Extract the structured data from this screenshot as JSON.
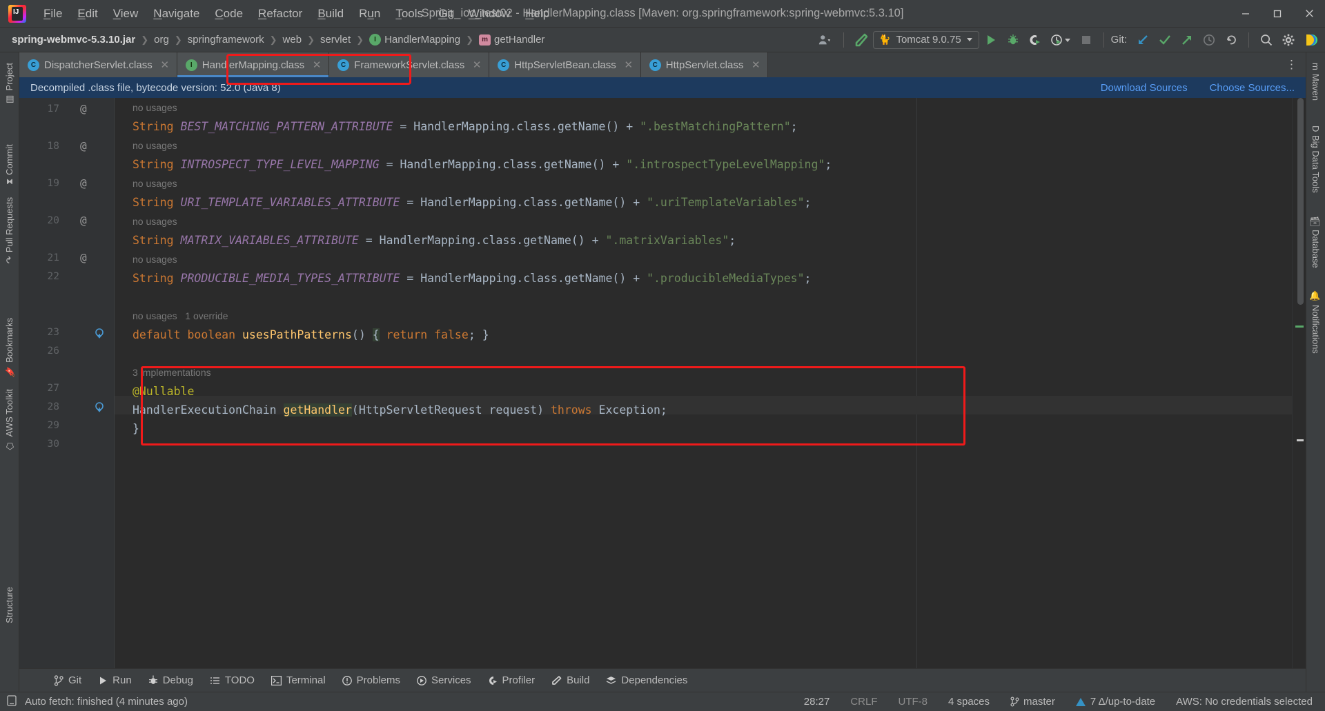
{
  "window": {
    "title": "Spring_ioc_test02 - HandlerMapping.class [Maven: org.springframework:spring-webmvc:5.3.10]",
    "minimize_label": "minimize-icon",
    "maximize_label": "maximize-icon",
    "close_label": "close-icon"
  },
  "menu": {
    "items": [
      {
        "label": "File",
        "mnemonic": "F"
      },
      {
        "label": "Edit",
        "mnemonic": "E"
      },
      {
        "label": "View",
        "mnemonic": "V"
      },
      {
        "label": "Navigate",
        "mnemonic": "N"
      },
      {
        "label": "Code",
        "mnemonic": "C"
      },
      {
        "label": "Refactor",
        "mnemonic": "R"
      },
      {
        "label": "Build",
        "mnemonic": "B"
      },
      {
        "label": "Run",
        "mnemonic": "u"
      },
      {
        "label": "Tools",
        "mnemonic": "T"
      },
      {
        "label": "Git",
        "mnemonic": "G"
      },
      {
        "label": "Window",
        "mnemonic": "W"
      },
      {
        "label": "Help",
        "mnemonic": "H"
      }
    ]
  },
  "breadcrumbs": [
    {
      "label": "spring-webmvc-5.3.10.jar",
      "icon": ""
    },
    {
      "label": "org",
      "icon": ""
    },
    {
      "label": "springframework",
      "icon": ""
    },
    {
      "label": "web",
      "icon": ""
    },
    {
      "label": "servlet",
      "icon": ""
    },
    {
      "label": "HandlerMapping",
      "icon": "I"
    },
    {
      "label": "getHandler",
      "icon": "m"
    }
  ],
  "toolbar": {
    "profile_icon": "user-profile-icon",
    "build_icon": "build-hammer-icon",
    "run_config": "Tomcat 9.0.75",
    "run_config_icon": "tomcat-cat-icon",
    "run_icon": "run-play-icon",
    "debug_icon": "debug-bug-icon",
    "run_coverage_icon": "run-with-coverage-icon",
    "profiler_icon": "profiler-clock-icon",
    "stop_icon": "stop-square-icon",
    "git_label": "Git:",
    "git_update_icon": "git-update-project-icon",
    "git_commit_icon": "git-commit-checkmark-icon",
    "git_push_icon": "git-push-arrow-icon",
    "git_history_icon": "git-history-clock-icon",
    "git_rollback_icon": "git-rollback-icon",
    "search_icon": "search-icon",
    "settings_icon": "gear-icon",
    "ai_icon": "ai-assistant-icon"
  },
  "left_rail": [
    {
      "label": "Project",
      "icon": "project-icon"
    },
    {
      "label": "Commit",
      "icon": "commit-icon"
    },
    {
      "label": "Pull Requests",
      "icon": "pull-requests-icon"
    },
    {
      "label": "Bookmarks",
      "icon": "bookmark-icon"
    },
    {
      "label": "AWS Toolkit",
      "icon": "aws-toolkit-icon"
    },
    {
      "label": "Structure",
      "icon": "structure-icon"
    }
  ],
  "right_rail": [
    {
      "label": "Maven",
      "icon": "maven-icon"
    },
    {
      "label": "Big Data Tools",
      "icon": "big-data-tools-icon"
    },
    {
      "label": "Database",
      "icon": "database-icon"
    },
    {
      "label": "Notifications",
      "icon": "notifications-icon"
    }
  ],
  "tabs": [
    {
      "label": "DispatcherServlet.class",
      "icon": "C",
      "active": false
    },
    {
      "label": "HandlerMapping.class",
      "icon": "I",
      "active": true
    },
    {
      "label": "FrameworkServlet.class",
      "icon": "C",
      "active": false
    },
    {
      "label": "HttpServletBean.class",
      "icon": "C",
      "active": false
    },
    {
      "label": "HttpServlet.class",
      "icon": "C",
      "active": false
    }
  ],
  "tabs_overflow_icon": "more-options-icon",
  "banner": {
    "message": "Decompiled .class file, bytecode version: 52.0 (Java 8)",
    "download_sources": "Download Sources",
    "choose_sources": "Choose Sources..."
  },
  "editor": {
    "lines": [
      {
        "num": "",
        "ann": "",
        "hint": "no usages",
        "type": "hint"
      },
      {
        "num": "17",
        "ann": "@",
        "type": "code",
        "id": "l17"
      },
      {
        "num": "",
        "ann": "",
        "hint": "no usages",
        "type": "hint"
      },
      {
        "num": "18",
        "ann": "@",
        "type": "code",
        "id": "l18"
      },
      {
        "num": "",
        "ann": "",
        "hint": "no usages",
        "type": "hint"
      },
      {
        "num": "19",
        "ann": "@",
        "type": "code",
        "id": "l19"
      },
      {
        "num": "",
        "ann": "",
        "hint": "no usages",
        "type": "hint"
      },
      {
        "num": "20",
        "ann": "@",
        "type": "code",
        "id": "l20"
      },
      {
        "num": "",
        "ann": "",
        "hint": "no usages",
        "type": "hint"
      },
      {
        "num": "21",
        "ann": "@",
        "type": "code",
        "id": "l21"
      },
      {
        "num": "22",
        "ann": "",
        "type": "blank"
      },
      {
        "num": "",
        "ann": "",
        "hint": "no usages   1 override",
        "type": "hint"
      },
      {
        "num": "23",
        "ann": "",
        "type": "code",
        "id": "l23"
      },
      {
        "num": "26",
        "ann": "",
        "type": "blank"
      },
      {
        "num": "",
        "ann": "",
        "hint": "3 implementations",
        "type": "hint"
      },
      {
        "num": "27",
        "ann": "",
        "type": "code",
        "id": "l27"
      },
      {
        "num": "28",
        "ann": "",
        "type": "code",
        "id": "l28"
      },
      {
        "num": "29",
        "ann": "",
        "type": "code",
        "id": "l29"
      },
      {
        "num": "30",
        "ann": "",
        "type": "blank"
      }
    ],
    "source": {
      "l17_keyword": "String",
      "l17_field": "BEST_MATCHING_PATTERN_ATTRIBUTE",
      "l17_expr": " = HandlerMapping.class.getName() + ",
      "l17_string": "\".bestMatchingPattern\"",
      "l18_keyword": "String",
      "l18_field": "INTROSPECT_TYPE_LEVEL_MAPPING",
      "l18_expr": " = HandlerMapping.class.getName() + ",
      "l18_string": "\".introspectTypeLevelMapping\"",
      "l19_keyword": "String",
      "l19_field": "URI_TEMPLATE_VARIABLES_ATTRIBUTE",
      "l19_expr": " = HandlerMapping.class.getName() + ",
      "l19_string": "\".uriTemplateVariables\"",
      "l20_keyword": "String",
      "l20_field": "MATRIX_VARIABLES_ATTRIBUTE",
      "l20_expr": " = HandlerMapping.class.getName() + ",
      "l20_string": "\".matrixVariables\"",
      "l21_keyword": "String",
      "l21_field": "PRODUCIBLE_MEDIA_TYPES_ATTRIBUTE",
      "l21_expr": " = HandlerMapping.class.getName() + ",
      "l21_string": "\".producibleMediaTypes\"",
      "l23_text": "default boolean usesPathPatterns() { return false; }",
      "l27_text": "@Nullable",
      "l28_text": "HandlerExecutionChain getHandler(HttpServletRequest request) throws Exception;",
      "l29_text": "}"
    },
    "gutter_icons": {
      "implemented_icon": "implemented-method-icon",
      "fold_icon": "code-fold-icon"
    },
    "highlight_color": "#f01a1a"
  },
  "bottom_tools": [
    {
      "label": "Git",
      "icon": "git-branch-icon"
    },
    {
      "label": "Run",
      "icon": "run-play-icon"
    },
    {
      "label": "Debug",
      "icon": "debug-bug-icon"
    },
    {
      "label": "TODO",
      "icon": "todo-list-icon"
    },
    {
      "label": "Terminal",
      "icon": "terminal-icon"
    },
    {
      "label": "Problems",
      "icon": "problems-icon"
    },
    {
      "label": "Services",
      "icon": "services-icon"
    },
    {
      "label": "Profiler",
      "icon": "profiler-icon"
    },
    {
      "label": "Build",
      "icon": "build-hammer-icon"
    },
    {
      "label": "Dependencies",
      "icon": "dependencies-icon"
    }
  ],
  "status_bar": {
    "message_icon": "event-log-icon",
    "message": "Auto fetch: finished (4 minutes ago)",
    "caret_position": "28:27",
    "line_separator": "CRLF",
    "encoding": "UTF-8",
    "indent": "4 spaces",
    "branch_icon": "git-branch-icon",
    "branch": "master",
    "updates_icon": "update-available-icon",
    "updates": "7 Δ/up-to-date",
    "aws": "AWS: No credentials selected"
  }
}
